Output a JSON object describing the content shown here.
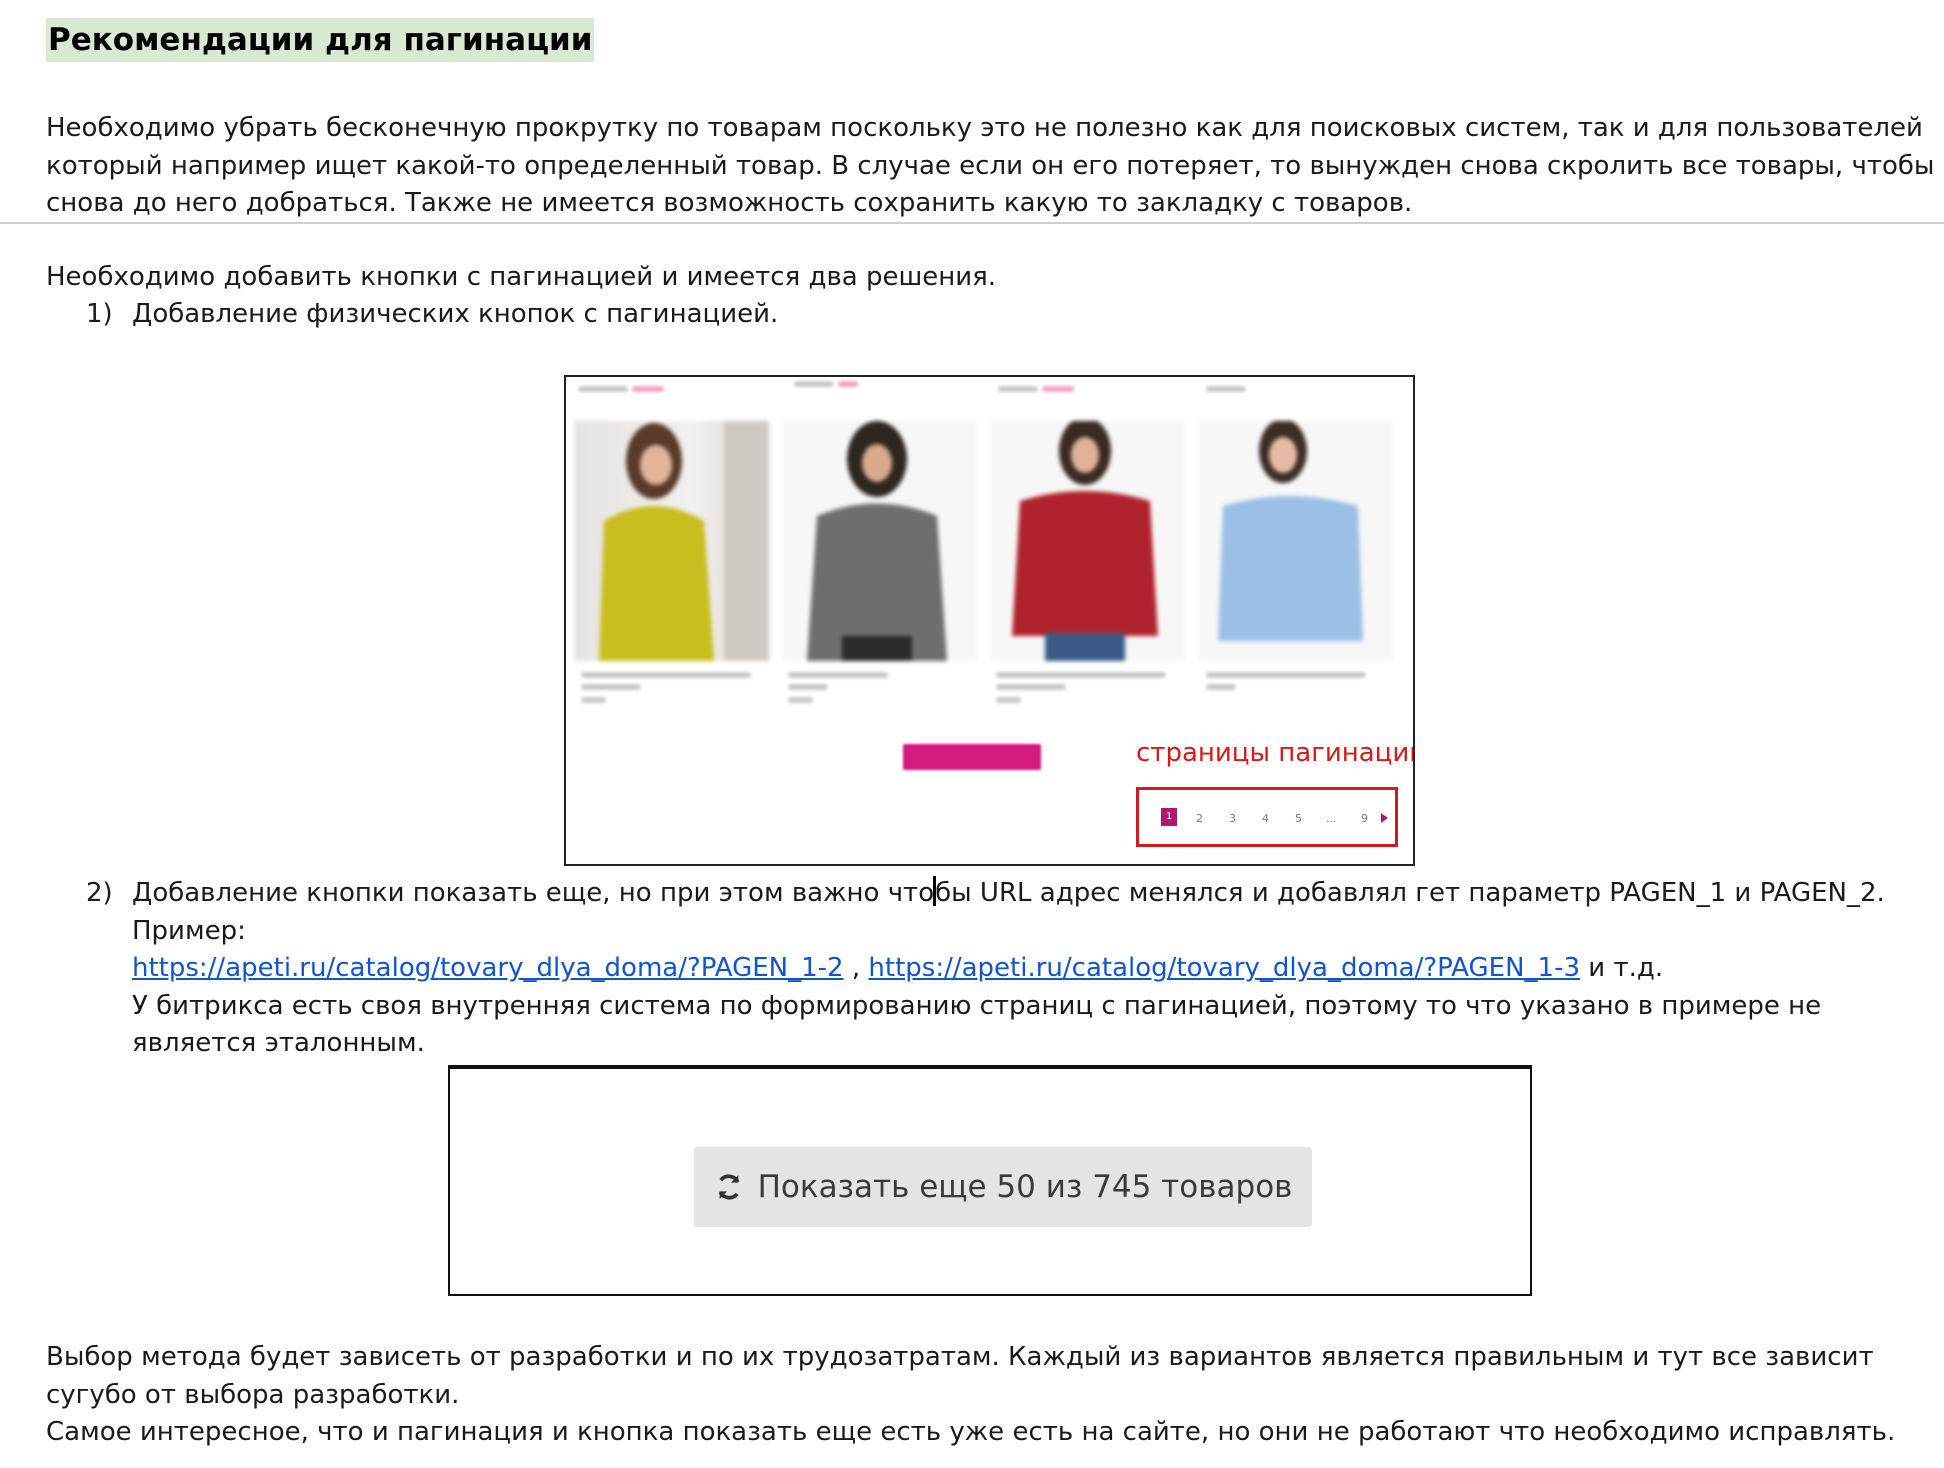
{
  "heading": "Рекомендации для пагинации",
  "intro_lines": [
    "Необходимо убрать бесконечную прокрутку по товарам поскольку это не полезно как для поисковых систем, так и для пользователей",
    "который например ищет какой-то определенный товар. В случае если он его потеряет, то вынужден снова скролить все товары, чтобы",
    "снова до него добраться. Также не имеется возможность сохранить какую то закладку с товаров."
  ],
  "solutions_intro": "Необходимо добавить кнопки с пагинацией и имеется два решения.",
  "item1": {
    "num": "1)",
    "text": "Добавление физических кнопок с пагинацией."
  },
  "figure1": {
    "caption": "страницы пагинации",
    "pages": [
      "1",
      "2",
      "3",
      "4",
      "5",
      "...",
      "9"
    ],
    "product_colors": [
      "#c8be1e",
      "#6e6e6e",
      "#b0232e",
      "#9cbfe8"
    ]
  },
  "item2": {
    "num": "2)",
    "line1_a": "Добавление кнопки показать еще, но при этом важно что",
    "line1_b": "бы URL адрес менялся и добавлял гет параметр PAGEN_1 и PAGEN_2.",
    "example_label": "Пример:",
    "link1": "https://apeti.ru/catalog/tovary_dlya_doma/?PAGEN_1-2",
    "separator": " , ",
    "link2": "https://apeti.ru/catalog/tovary_dlya_doma/?PAGEN_1-3",
    "etc": " и т.д.",
    "note_line1": "У битрикса есть своя внутренняя система по формированию страниц с пагинацией, поэтому то что указано в примере не",
    "note_line2": "является эталонным."
  },
  "figure2": {
    "button_label": "Показать еще 50 из 745 товаров",
    "icon": "refresh-icon"
  },
  "conclusion_lines": [
    "Выбор метода будет зависеть от разработки и по их трудозатратам. Каждый из вариантов является правильным и тут все зависит",
    "сугубо от выбора разработки.",
    "Самое интересное, что и пагинация и кнопка показать еще есть уже есть на сайте, но они не работают что необходимо исправлять."
  ]
}
